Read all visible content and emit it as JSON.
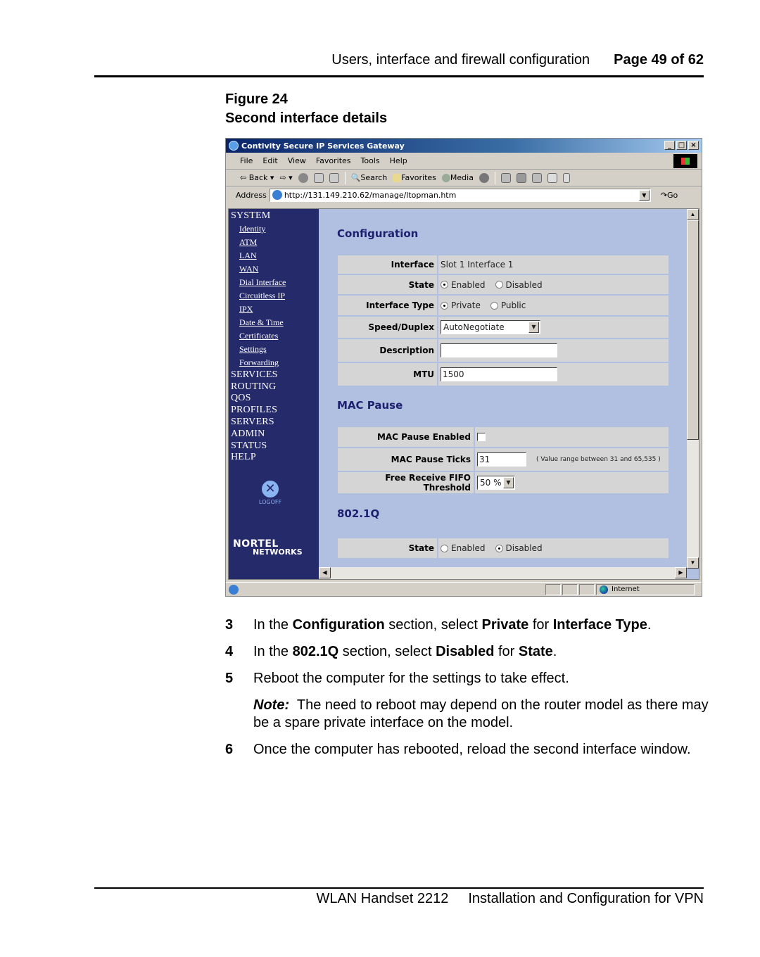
{
  "header": {
    "section": "Users, interface and firewall configuration",
    "page": "Page 49 of 62"
  },
  "figure": {
    "number": "Figure 24",
    "caption": "Second interface details"
  },
  "browser": {
    "title": "Contivity Secure IP Services Gateway",
    "window_buttons": [
      "_",
      "□",
      "×"
    ],
    "menu": [
      "File",
      "Edit",
      "View",
      "Favorites",
      "Tools",
      "Help"
    ],
    "toolbar": {
      "back": "Back",
      "search": "Search",
      "favorites": "Favorites",
      "media": "Media"
    },
    "address_label": "Address",
    "url": "http://131.149.210.62/manage/ltopman.htm",
    "go": "Go",
    "status_zone": "Internet"
  },
  "nav": {
    "system": "SYSTEM",
    "system_items": [
      "Identity",
      "ATM",
      "LAN",
      "WAN",
      "Dial Interface",
      "Circuitless IP",
      "IPX",
      "Date & Time",
      "Certificates",
      "Settings",
      "Forwarding"
    ],
    "sections": [
      "SERVICES",
      "ROUTING",
      "QOS",
      "PROFILES",
      "SERVERS",
      "ADMIN",
      "STATUS",
      "HELP"
    ],
    "logoff": "LOGOFF",
    "logo_line1": "NORTEL",
    "logo_line2": "NETWORKS"
  },
  "config": {
    "title": "Configuration",
    "interface_label": "Interface",
    "interface_value": "Slot 1 Interface 1",
    "state_label": "State",
    "state_options": [
      "Enabled",
      "Disabled"
    ],
    "state_selected": "Enabled",
    "type_label": "Interface Type",
    "type_options": [
      "Private",
      "Public"
    ],
    "type_selected": "Private",
    "speed_label": "Speed/Duplex",
    "speed_value": "AutoNegotiate",
    "description_label": "Description",
    "description_value": "",
    "mtu_label": "MTU",
    "mtu_value": "1500"
  },
  "mac_pause": {
    "title": "MAC Pause",
    "enabled_label": "MAC Pause Enabled",
    "enabled_checked": false,
    "ticks_label": "MAC Pause Ticks",
    "ticks_value": "31",
    "ticks_hint": "( Value range between 31 and 65,535 )",
    "fifo_label": "Free Receive FIFO Threshold",
    "fifo_value": "50 %"
  },
  "dot1q": {
    "title": "802.1Q",
    "state_label": "State",
    "state_options": [
      "Enabled",
      "Disabled"
    ],
    "state_selected": "Disabled"
  },
  "steps": [
    {
      "n": "3",
      "parts": [
        [
          "In the ",
          false
        ],
        [
          "Configuration",
          true
        ],
        [
          " section, select ",
          false
        ],
        [
          "Private",
          true
        ],
        [
          " for ",
          false
        ],
        [
          "Interface Type",
          true
        ],
        [
          ".",
          false
        ]
      ]
    },
    {
      "n": "4",
      "parts": [
        [
          "In the ",
          false
        ],
        [
          "802.1Q",
          true
        ],
        [
          " section, select ",
          false
        ],
        [
          "Disabled",
          true
        ],
        [
          " for ",
          false
        ],
        [
          "State",
          true
        ],
        [
          ".",
          false
        ]
      ]
    },
    {
      "n": "5",
      "parts": [
        [
          "Reboot the computer for the settings to take effect.",
          false
        ]
      ]
    }
  ],
  "note": {
    "label": "Note:",
    "text": "The need to reboot may depend on the router model as there may be a spare private interface on the model."
  },
  "step6": {
    "n": "6",
    "text": "Once the computer has rebooted, reload the second interface window."
  },
  "footer": {
    "product": "WLAN Handset 2212",
    "doc": "Installation and Configuration for VPN"
  }
}
